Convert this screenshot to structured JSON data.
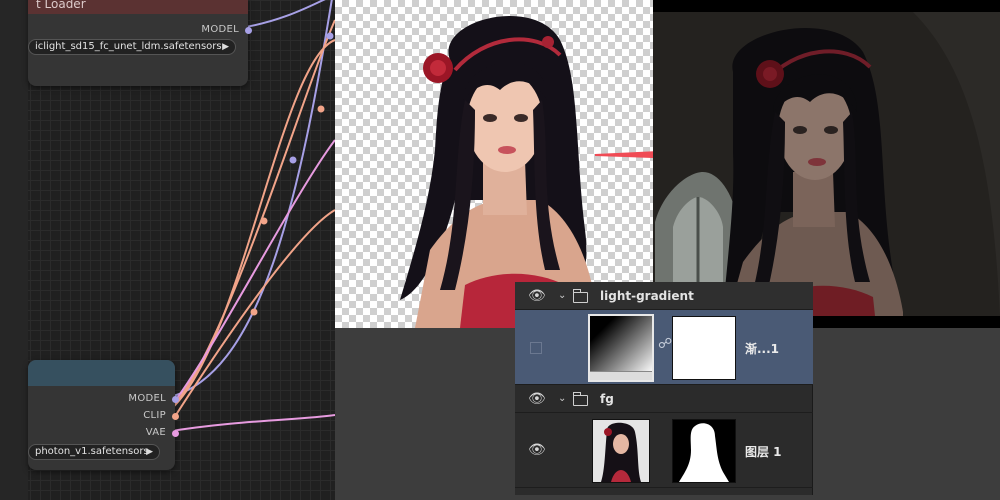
{
  "graph": {
    "node_top": {
      "title": "t Loader",
      "output_label": "MODEL",
      "widget_value": "iclight_sd15_fc_unet_ldm.safetensors"
    },
    "node_bottom": {
      "outputs": [
        "MODEL",
        "CLIP",
        "VAE"
      ],
      "widget_value": "photon_v1.safetensors"
    }
  },
  "layers_panel": {
    "groups": [
      {
        "name": "light-gradient",
        "layer_name": "渐...1"
      },
      {
        "name": "fg",
        "layer_name": "图层 1"
      }
    ]
  },
  "colors": {
    "arrow": "#f04b55",
    "wire_model": "#a7a0e6",
    "wire_clip": "#f2a489",
    "wire_vae": "#e79be0",
    "selected_row": "#4a5a75"
  },
  "icons": [
    "eye-icon",
    "chevron-down-icon",
    "folder-icon",
    "link-icon",
    "arrow-right-icon",
    "dropdown-arrow-icon"
  ]
}
